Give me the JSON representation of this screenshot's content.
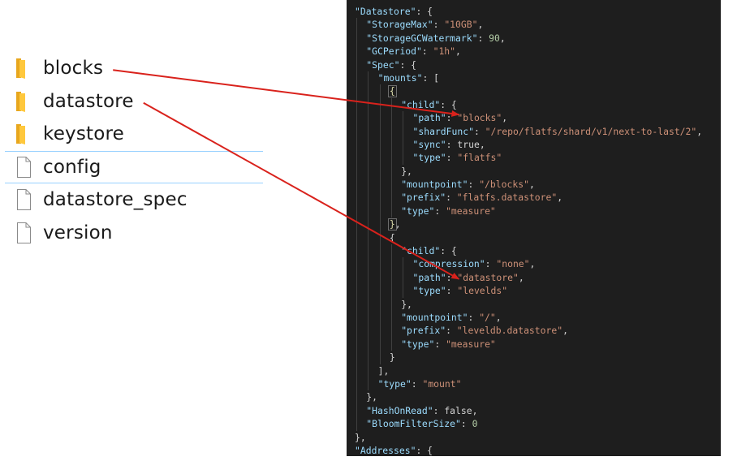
{
  "files": [
    {
      "name": "blocks",
      "kind": "folder"
    },
    {
      "name": "datastore",
      "kind": "folder"
    },
    {
      "name": "keystore",
      "kind": "folder"
    },
    {
      "name": "config",
      "kind": "file",
      "selected": true
    },
    {
      "name": "datastore_spec",
      "kind": "file"
    },
    {
      "name": "version",
      "kind": "file"
    }
  ],
  "colors": {
    "folder": "#ffc83d",
    "folder_shade": "#e8a71e",
    "code_bg": "#1e1e1e",
    "key": "#9cdcfe",
    "string": "#ce9178",
    "number": "#b5cea8",
    "arrow": "#d9221c"
  },
  "code": [
    {
      "indent": 0,
      "segs": [
        [
          "key",
          "\"Datastore\""
        ],
        [
          "punct",
          ": {"
        ]
      ]
    },
    {
      "indent": 1,
      "segs": [
        [
          "key",
          "\"StorageMax\""
        ],
        [
          "punct",
          ": "
        ],
        [
          "str",
          "\"10GB\""
        ],
        [
          "punct",
          ","
        ]
      ]
    },
    {
      "indent": 1,
      "segs": [
        [
          "key",
          "\"StorageGCWatermark\""
        ],
        [
          "punct",
          ": "
        ],
        [
          "num",
          "90"
        ],
        [
          "punct",
          ","
        ]
      ]
    },
    {
      "indent": 1,
      "segs": [
        [
          "key",
          "\"GCPeriod\""
        ],
        [
          "punct",
          ": "
        ],
        [
          "str",
          "\"1h\""
        ],
        [
          "punct",
          ","
        ]
      ]
    },
    {
      "indent": 1,
      "segs": [
        [
          "key",
          "\"Spec\""
        ],
        [
          "punct",
          ": {"
        ]
      ]
    },
    {
      "indent": 2,
      "segs": [
        [
          "key",
          "\"mounts\""
        ],
        [
          "punct",
          ": ["
        ]
      ]
    },
    {
      "indent": 3,
      "segs": [
        [
          "bracket",
          "{"
        ]
      ]
    },
    {
      "indent": 4,
      "segs": [
        [
          "key",
          "\"child\""
        ],
        [
          "punct",
          ": {"
        ]
      ]
    },
    {
      "indent": 5,
      "segs": [
        [
          "key",
          "\"path\""
        ],
        [
          "punct",
          ": "
        ],
        [
          "str",
          "\"blocks\""
        ],
        [
          "punct",
          ","
        ]
      ]
    },
    {
      "indent": 5,
      "segs": [
        [
          "key",
          "\"shardFunc\""
        ],
        [
          "punct",
          ": "
        ],
        [
          "str",
          "\"/repo/flatfs/shard/v1/next-to-last/2\""
        ],
        [
          "punct",
          ","
        ]
      ]
    },
    {
      "indent": 5,
      "segs": [
        [
          "key",
          "\"sync\""
        ],
        [
          "punct",
          ": "
        ],
        [
          "lit",
          "true"
        ],
        [
          "punct",
          ","
        ]
      ]
    },
    {
      "indent": 5,
      "segs": [
        [
          "key",
          "\"type\""
        ],
        [
          "punct",
          ": "
        ],
        [
          "str",
          "\"flatfs\""
        ]
      ]
    },
    {
      "indent": 4,
      "segs": [
        [
          "punct",
          "},"
        ]
      ]
    },
    {
      "indent": 4,
      "segs": [
        [
          "key",
          "\"mountpoint\""
        ],
        [
          "punct",
          ": "
        ],
        [
          "str",
          "\"/blocks\""
        ],
        [
          "punct",
          ","
        ]
      ]
    },
    {
      "indent": 4,
      "segs": [
        [
          "key",
          "\"prefix\""
        ],
        [
          "punct",
          ": "
        ],
        [
          "str",
          "\"flatfs.datastore\""
        ],
        [
          "punct",
          ","
        ]
      ]
    },
    {
      "indent": 4,
      "segs": [
        [
          "key",
          "\"type\""
        ],
        [
          "punct",
          ": "
        ],
        [
          "str",
          "\"measure\""
        ]
      ]
    },
    {
      "indent": 3,
      "segs": [
        [
          "bracket",
          "}"
        ],
        [
          "punct",
          ","
        ]
      ]
    },
    {
      "indent": 3,
      "segs": [
        [
          "punct",
          "{"
        ]
      ]
    },
    {
      "indent": 4,
      "segs": [
        [
          "key",
          "\"child\""
        ],
        [
          "punct",
          ": {"
        ]
      ]
    },
    {
      "indent": 5,
      "segs": [
        [
          "key",
          "\"compression\""
        ],
        [
          "punct",
          ": "
        ],
        [
          "str",
          "\"none\""
        ],
        [
          "punct",
          ","
        ]
      ]
    },
    {
      "indent": 5,
      "segs": [
        [
          "key",
          "\"path\""
        ],
        [
          "punct",
          ": "
        ],
        [
          "str",
          "\"datastore\""
        ],
        [
          "punct",
          ","
        ]
      ]
    },
    {
      "indent": 5,
      "segs": [
        [
          "key",
          "\"type\""
        ],
        [
          "punct",
          ": "
        ],
        [
          "str",
          "\"levelds\""
        ]
      ]
    },
    {
      "indent": 4,
      "segs": [
        [
          "punct",
          "},"
        ]
      ]
    },
    {
      "indent": 4,
      "segs": [
        [
          "key",
          "\"mountpoint\""
        ],
        [
          "punct",
          ": "
        ],
        [
          "str",
          "\"/\""
        ],
        [
          "punct",
          ","
        ]
      ]
    },
    {
      "indent": 4,
      "segs": [
        [
          "key",
          "\"prefix\""
        ],
        [
          "punct",
          ": "
        ],
        [
          "str",
          "\"leveldb.datastore\""
        ],
        [
          "punct",
          ","
        ]
      ]
    },
    {
      "indent": 4,
      "segs": [
        [
          "key",
          "\"type\""
        ],
        [
          "punct",
          ": "
        ],
        [
          "str",
          "\"measure\""
        ]
      ]
    },
    {
      "indent": 3,
      "segs": [
        [
          "punct",
          "}"
        ]
      ]
    },
    {
      "indent": 2,
      "segs": [
        [
          "punct",
          "],"
        ]
      ]
    },
    {
      "indent": 2,
      "segs": [
        [
          "key",
          "\"type\""
        ],
        [
          "punct",
          ": "
        ],
        [
          "str",
          "\"mount\""
        ]
      ]
    },
    {
      "indent": 1,
      "segs": [
        [
          "punct",
          "},"
        ]
      ]
    },
    {
      "indent": 1,
      "segs": [
        [
          "key",
          "\"HashOnRead\""
        ],
        [
          "punct",
          ": "
        ],
        [
          "lit",
          "false"
        ],
        [
          "punct",
          ","
        ]
      ]
    },
    {
      "indent": 1,
      "segs": [
        [
          "key",
          "\"BloomFilterSize\""
        ],
        [
          "punct",
          ": "
        ],
        [
          "num",
          "0"
        ]
      ]
    },
    {
      "indent": 0,
      "segs": [
        [
          "punct",
          "},"
        ]
      ]
    },
    {
      "indent": 0,
      "segs": [
        [
          "key",
          "\"Addresses\""
        ],
        [
          "punct",
          ": {"
        ]
      ]
    }
  ],
  "arrows": [
    {
      "from": "blocks",
      "to": "\"blocks\""
    },
    {
      "from": "datastore",
      "to": "\"datastore\""
    }
  ]
}
